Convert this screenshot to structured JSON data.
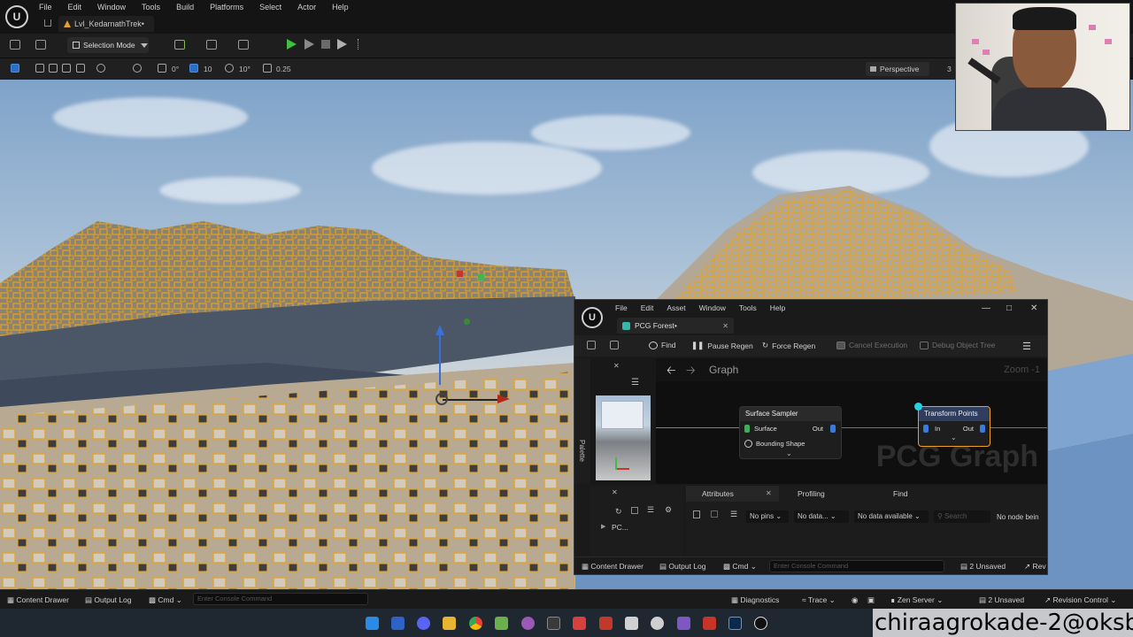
{
  "menubar": {
    "items": [
      "File",
      "Edit",
      "Window",
      "Tools",
      "Build",
      "Platforms",
      "Select",
      "Actor",
      "Help"
    ],
    "level_tab": "Lvl_KedarnathTrek•",
    "logo": "U"
  },
  "toolbar": {
    "mode_label": "Selection Mode"
  },
  "viewport_toolbar": {
    "rot_snap": "0°",
    "grid_snap": "10",
    "angle_snap": "10°",
    "scale_snap": "0.25",
    "view_mode": "Perspective",
    "speed": "3"
  },
  "pcg_window": {
    "menu": [
      "File",
      "Edit",
      "Asset",
      "Window",
      "Tools",
      "Help"
    ],
    "tab_title": "PCG Forest•",
    "toolbar": {
      "find": "Find",
      "pause_regen": "Pause Regen",
      "force_regen": "Force Regen",
      "cancel_execution": "Cancel Execution",
      "debug_object_tree": "Debug Object Tree"
    },
    "palette_label": "Palette",
    "graph": {
      "breadcrumb": "Graph",
      "zoom": "Zoom -1",
      "watermark": "PCG Graph",
      "nodes": [
        {
          "title": "Surface Sampler",
          "pins": [
            "Surface",
            "Bounding Shape"
          ],
          "out": "Out",
          "title_color": "#2a2a2a"
        },
        {
          "title": "Transform Points",
          "pins": [
            "In"
          ],
          "out": "Out",
          "title_color": "#2f3e5e"
        }
      ]
    },
    "bottom": {
      "tree_item": "PC...",
      "tabs": [
        "Attributes",
        "Profiling",
        "Find"
      ],
      "pins_dropdown": "No pins",
      "data_dropdown": "No data...",
      "data_available": "No data available",
      "search_placeholder": "Search",
      "node_info": "No node bein"
    },
    "status": {
      "content_drawer": "Content Drawer",
      "output_log": "Output Log",
      "cmd": "Cmd",
      "console_placeholder": "Enter Console Command",
      "unsaved": "2 Unsaved",
      "revision": "Rev"
    }
  },
  "statusbar": {
    "content_drawer": "Content Drawer",
    "output_log": "Output Log",
    "cmd": "Cmd",
    "console_placeholder": "Enter Console Command",
    "diagnostics": "Diagnostics",
    "trace": "Trace",
    "zen_server": "Zen Server",
    "unsaved": "2 Unsaved",
    "revision_control": "Revision Control"
  },
  "overlay": {
    "text": "chiraagrokade-2@oksbi"
  },
  "colors": {
    "foliage_outline": "#e8a21a",
    "play_green": "#3fbf3f",
    "selection_orange": "#f0a020",
    "wire_blue": "#3b7ad8"
  }
}
